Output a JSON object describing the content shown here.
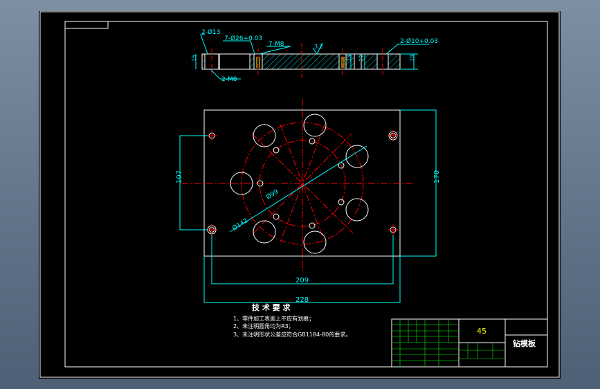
{
  "colors": {
    "background": "#000000",
    "outline": "#ffffff",
    "dimension": "#00ffff",
    "centerline": "#ff0000",
    "note_text": "#ffffff",
    "material_text": "#ffff00",
    "table_grid": "#00ff00"
  },
  "section_view": {
    "labels": {
      "through_holes_13": "2-Ø13",
      "counterbore_26": "7-Ø26+0.03",
      "threaded_m8": "7-M8",
      "surface_finish": "3.2",
      "dowel_holes_10": "2-Ø10+0.03",
      "bottom_m8": "2-M8",
      "height_15": "15",
      "height_12": "12",
      "height_13": "13",
      "height_19": "19"
    }
  },
  "plan_view": {
    "dimensions": {
      "height_107": "107",
      "height_170": "170",
      "width_209": "209",
      "width_228": "228",
      "diameter_99": "Ø99",
      "diameter_142": "Ø142"
    }
  },
  "notes": {
    "title": "技 术 要 求",
    "items": [
      "1、零件加工表面上不应有划痕；",
      "2、未注明圆角均为R3；",
      "3、未注明形状公差应符合GB1184-80的要求。"
    ]
  },
  "title_block": {
    "material": "45",
    "part_name": "钻模板"
  }
}
